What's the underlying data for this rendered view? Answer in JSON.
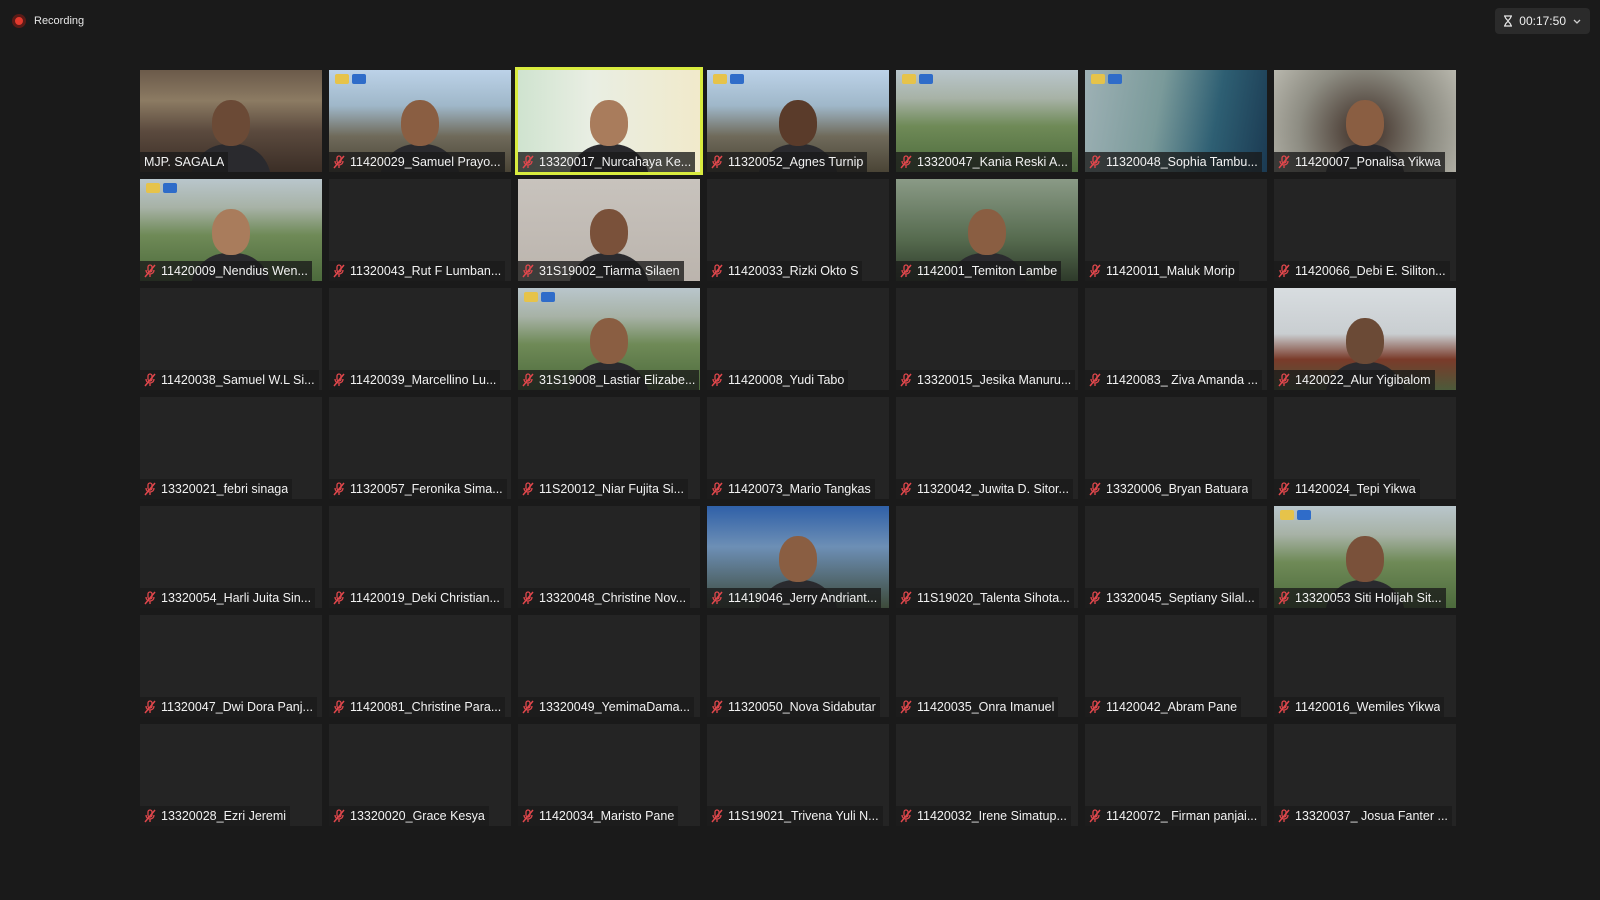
{
  "recording": {
    "label": "Recording"
  },
  "timer": {
    "value": "00:17:50"
  },
  "colors": {
    "active_speaker": "#d9ec3f",
    "mute": "#e0474c",
    "recording": "#e23a2e"
  },
  "participants": [
    {
      "name": "MJP. SAGALA",
      "muted": false,
      "video": "library",
      "person": true,
      "active": false
    },
    {
      "name": "11420029_Samuel Prayo...",
      "muted": true,
      "video": "pillars",
      "person": true,
      "logo": true,
      "active": false
    },
    {
      "name": "13320017_Nurcahaya Ke...",
      "muted": true,
      "video": "room-green",
      "person": true,
      "active": true
    },
    {
      "name": "11320052_Agnes Turnip",
      "muted": true,
      "video": "pillars",
      "person": true,
      "logo": true,
      "active": false
    },
    {
      "name": "13320047_Kania Reski A...",
      "muted": true,
      "video": "campus",
      "person": false,
      "logo": true,
      "active": false
    },
    {
      "name": "11320048_Sophia Tambu...",
      "muted": true,
      "video": "campus-tech",
      "person": false,
      "logo": true,
      "active": false
    },
    {
      "name": "11420007_Ponalisa Yikwa",
      "muted": true,
      "video": "blur",
      "person": true,
      "active": false
    },
    {
      "name": "11420009_Nendius Wen...",
      "muted": true,
      "video": "campus",
      "person": true,
      "logo": true,
      "active": false
    },
    {
      "name": "11320043_Rut F Lumban...",
      "muted": true,
      "video": null,
      "active": false
    },
    {
      "name": "31S19002_Tiarma Silaen",
      "muted": true,
      "video": "wall",
      "person": true,
      "active": false
    },
    {
      "name": "11420033_Rizki Okto S",
      "muted": true,
      "video": null,
      "active": false
    },
    {
      "name": "1142001_Temiton Lambe",
      "muted": true,
      "video": "trees",
      "person": true,
      "active": false
    },
    {
      "name": "11420011_Maluk Morip",
      "muted": true,
      "video": null,
      "active": false
    },
    {
      "name": "11420066_Debi E. Siliton...",
      "muted": true,
      "video": null,
      "active": false
    },
    {
      "name": "11420038_Samuel W.L Si...",
      "muted": true,
      "video": null,
      "active": false
    },
    {
      "name": "11420039_Marcellino Lu...",
      "muted": true,
      "video": null,
      "active": false
    },
    {
      "name": "31S19008_Lastiar Elizabe...",
      "muted": true,
      "video": "campus",
      "person": true,
      "logo": true,
      "active": false
    },
    {
      "name": "11420008_Yudi Tabo",
      "muted": true,
      "video": null,
      "active": false
    },
    {
      "name": "13320015_Jesika Manuru...",
      "muted": true,
      "video": null,
      "active": false
    },
    {
      "name": "11420083_ Ziva Amanda ...",
      "muted": true,
      "video": null,
      "active": false
    },
    {
      "name": "1420022_Alur Yigibalom",
      "muted": true,
      "video": "roof",
      "person": true,
      "active": false
    },
    {
      "name": "13320021_febri sinaga",
      "muted": true,
      "video": null,
      "active": false
    },
    {
      "name": "11320057_Feronika Sima...",
      "muted": true,
      "video": null,
      "active": false
    },
    {
      "name": "11S20012_Niar Fujita Si...",
      "muted": true,
      "video": null,
      "active": false
    },
    {
      "name": "11420073_Mario Tangkas",
      "muted": true,
      "video": null,
      "active": false
    },
    {
      "name": "11320042_Juwita D. Sitor...",
      "muted": true,
      "video": null,
      "active": false
    },
    {
      "name": "13320006_Bryan Batuara",
      "muted": true,
      "video": null,
      "active": false
    },
    {
      "name": "11420024_Tepi Yikwa",
      "muted": true,
      "video": null,
      "active": false
    },
    {
      "name": "13320054_Harli Juita Sin...",
      "muted": true,
      "video": null,
      "active": false
    },
    {
      "name": "11420019_Deki Christian...",
      "muted": true,
      "video": null,
      "active": false
    },
    {
      "name": "13320048_Christine Nov...",
      "muted": true,
      "video": null,
      "active": false
    },
    {
      "name": "11419046_Jerry Andriant...",
      "muted": true,
      "video": "sky",
      "person": true,
      "active": false
    },
    {
      "name": "11S19020_Talenta Sihota...",
      "muted": true,
      "video": null,
      "active": false
    },
    {
      "name": "13320045_Septiany Silal...",
      "muted": true,
      "video": null,
      "active": false
    },
    {
      "name": "13320053 Siti Holijah Sit...",
      "muted": true,
      "video": "campus",
      "person": true,
      "logo": true,
      "active": false
    },
    {
      "name": "11320047_Dwi Dora Panj...",
      "muted": true,
      "video": null,
      "active": false
    },
    {
      "name": "11420081_Christine Para...",
      "muted": true,
      "video": null,
      "active": false
    },
    {
      "name": "13320049_YemimaDama...",
      "muted": true,
      "video": null,
      "active": false
    },
    {
      "name": "11320050_Nova Sidabutar",
      "muted": true,
      "video": null,
      "active": false
    },
    {
      "name": "11420035_Onra Imanuel",
      "muted": true,
      "video": null,
      "active": false
    },
    {
      "name": "11420042_Abram Pane",
      "muted": true,
      "video": null,
      "active": false
    },
    {
      "name": "11420016_Wemiles Yikwa",
      "muted": true,
      "video": null,
      "active": false
    },
    {
      "name": "13320028_Ezri Jeremi",
      "muted": true,
      "video": null,
      "active": false
    },
    {
      "name": "13320020_Grace Kesya",
      "muted": true,
      "video": null,
      "active": false
    },
    {
      "name": "11420034_Maristo Pane",
      "muted": true,
      "video": null,
      "active": false
    },
    {
      "name": "11S19021_Trivena Yuli N...",
      "muted": true,
      "video": null,
      "active": false
    },
    {
      "name": "11420032_Irene Simatup...",
      "muted": true,
      "video": null,
      "active": false
    },
    {
      "name": "11420072_ Firman panjai...",
      "muted": true,
      "video": null,
      "active": false
    },
    {
      "name": "13320037_ Josua Fanter ...",
      "muted": true,
      "video": null,
      "active": false
    }
  ]
}
